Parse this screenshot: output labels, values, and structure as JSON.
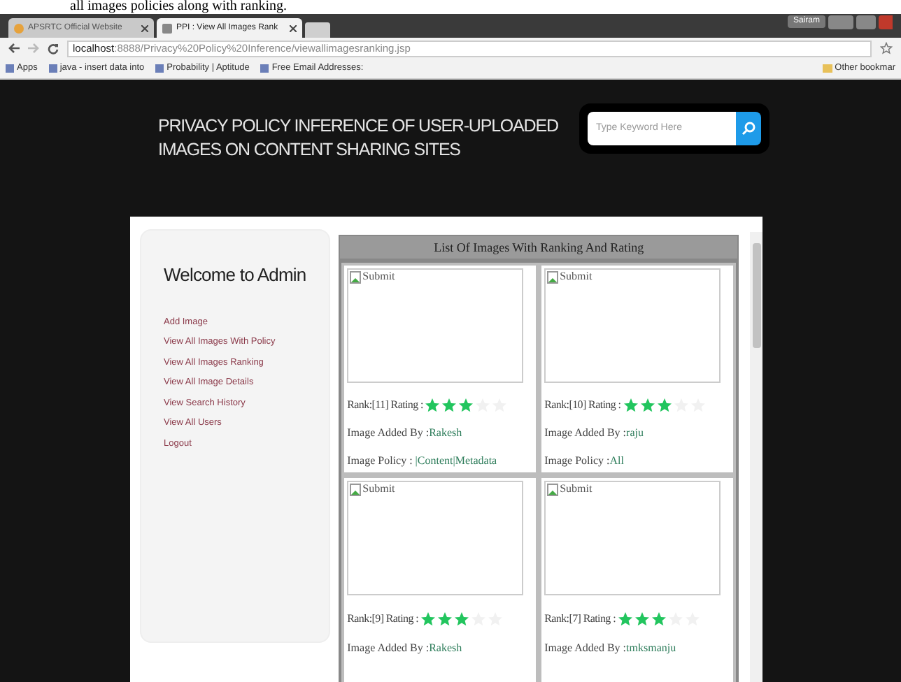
{
  "caption": "all images policies along with ranking.",
  "browser": {
    "tabs": [
      {
        "label": "APSRTC Official Website",
        "selected": false
      },
      {
        "label": "PPI : View All Images Rank",
        "selected": true
      }
    ],
    "user": "Sairam",
    "url_host": "localhost",
    "url_rest": ":8888/Privacy%20Policy%20Inference/viewallimagesranking.jsp",
    "bookmarks": [
      "Apps",
      "java - insert data into",
      "Probability | Aptitude",
      "Free Email Addresses:"
    ],
    "other_bookmarks": "Other bookmar"
  },
  "site_title": [
    "PRIVACY POLICY INFERENCE OF USER-UPLOADED",
    "IMAGES ON CONTENT SHARING SITES"
  ],
  "search": {
    "placeholder": "Type Keyword Here"
  },
  "sidebar": {
    "heading": "Welcome to Admin",
    "items": [
      "Add Image",
      "View All Images With Policy",
      "View All Images Ranking",
      "View All Image Details",
      "View Search History",
      "View All Users",
      "Logout"
    ]
  },
  "table": {
    "title": "List Of Images With Ranking And Rating",
    "cells": [
      {
        "alt": "Submit",
        "rank": "Rank:[11] Rating :",
        "stars": 3,
        "added_label": "Image Added By :",
        "added_by": "Rakesh",
        "policy_label": "Image Policy : ",
        "policy": "|Content|Metadata"
      },
      {
        "alt": "Submit",
        "rank": "Rank:[10] Rating :",
        "stars": 3,
        "added_label": "Image Added By :",
        "added_by": "raju",
        "policy_label": "Image Policy :",
        "policy": "All"
      },
      {
        "alt": "Submit",
        "rank": "Rank:[9] Rating :",
        "stars": 3,
        "added_label": "Image Added By :",
        "added_by": "Rakesh"
      },
      {
        "alt": "Submit",
        "rank": "Rank:[7] Rating :",
        "stars": 3,
        "added_label": "Image Added By :",
        "added_by": "tmksmanju"
      }
    ]
  }
}
